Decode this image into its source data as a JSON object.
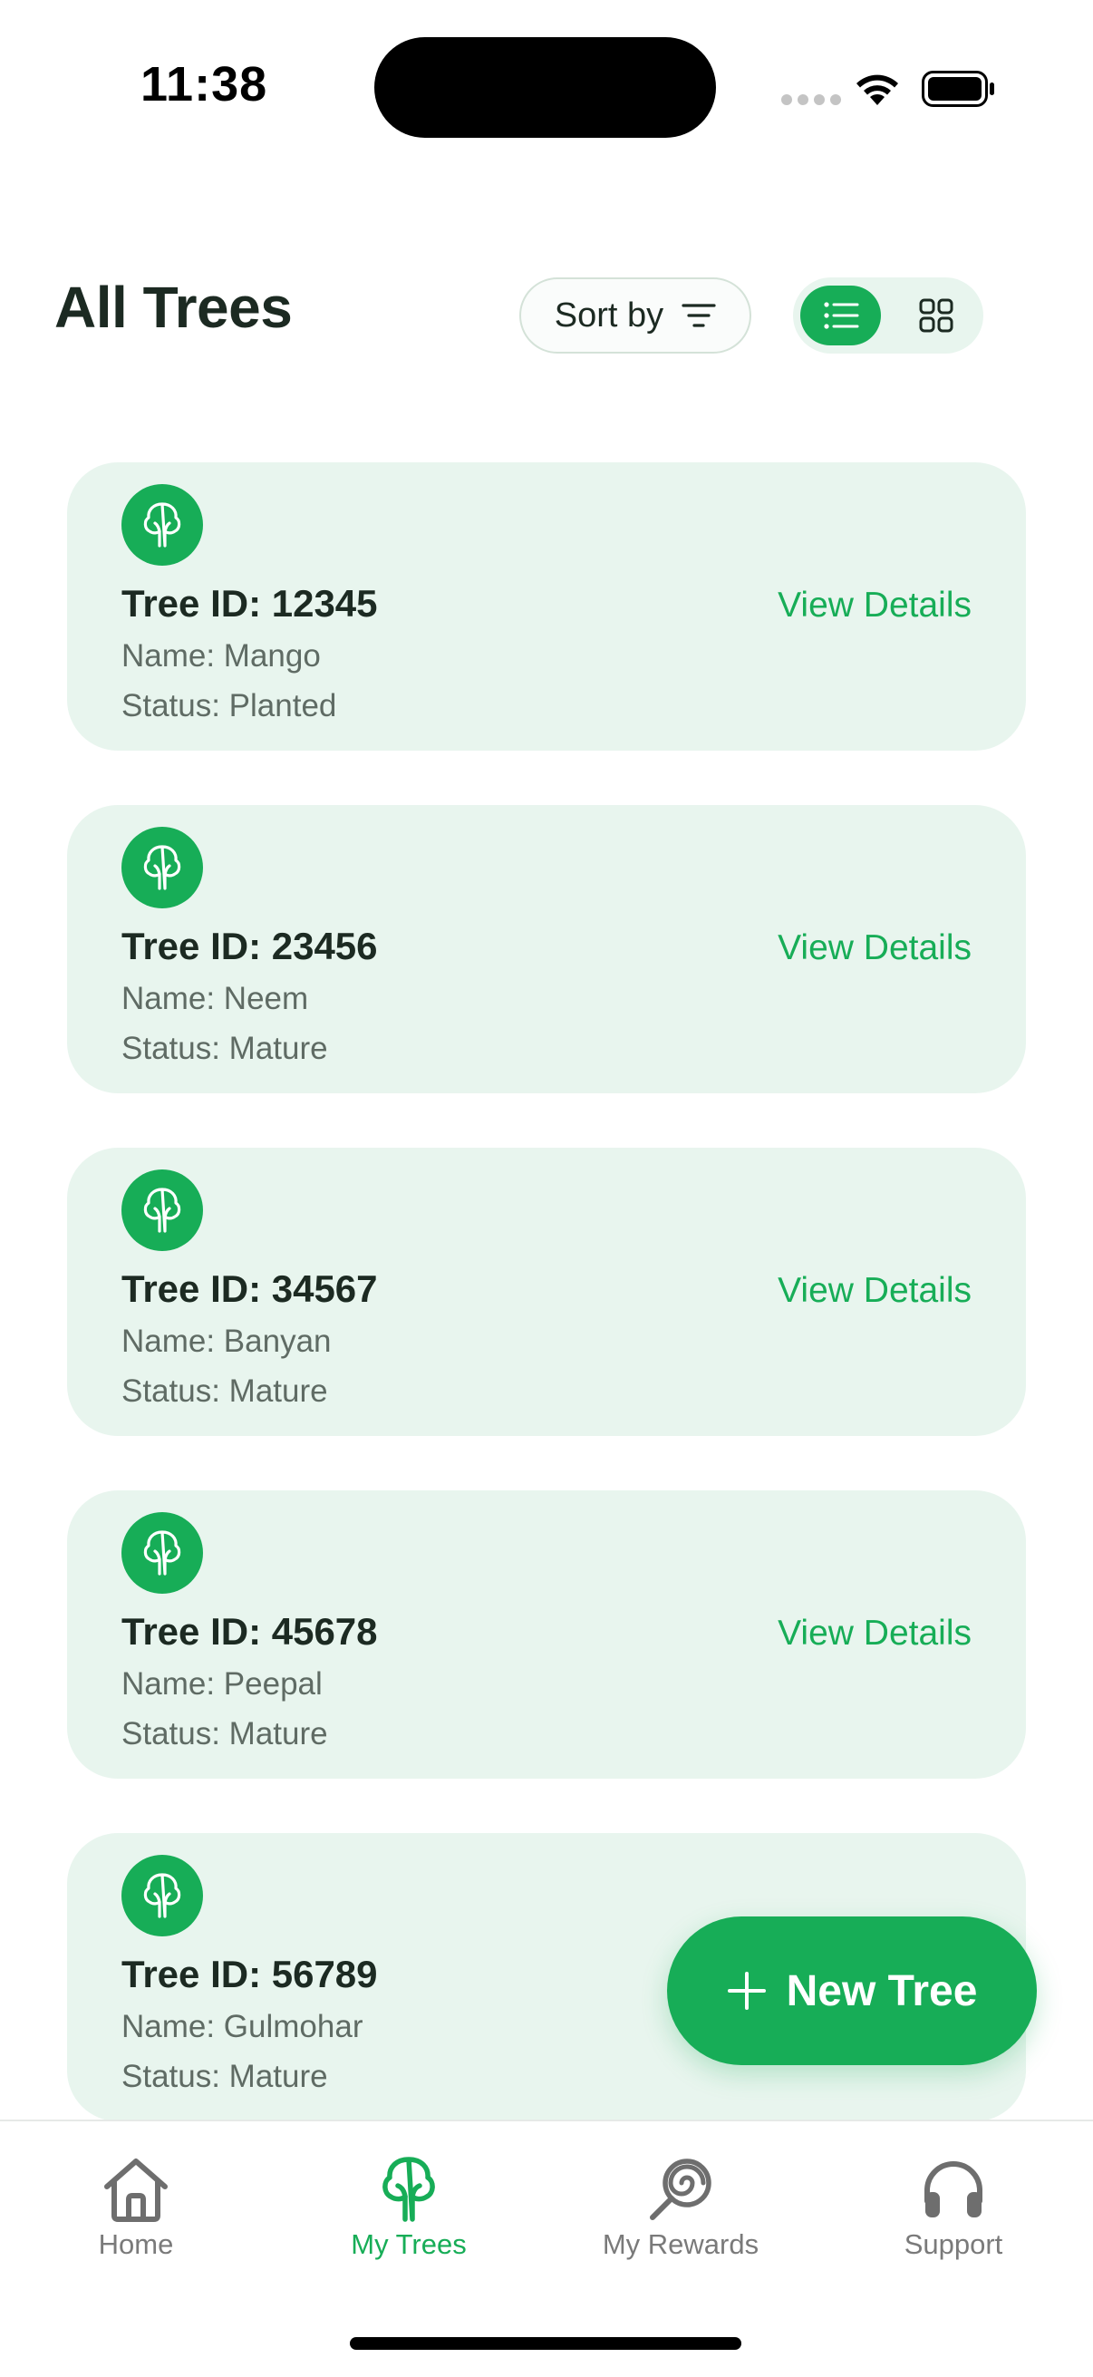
{
  "status_bar": {
    "time": "11:38"
  },
  "header": {
    "title": "All Trees",
    "sort_label": "Sort by",
    "view_modes": [
      "list",
      "grid"
    ],
    "active_view": "list"
  },
  "trees": [
    {
      "id_label": "Tree ID: 12345",
      "name_label": "Name: Mango",
      "status_label": "Status: Planted",
      "action": "View Details"
    },
    {
      "id_label": "Tree ID: 23456",
      "name_label": "Name: Neem",
      "status_label": "Status: Mature",
      "action": "View Details"
    },
    {
      "id_label": "Tree ID: 34567",
      "name_label": "Name: Banyan",
      "status_label": "Status: Mature",
      "action": "View Details"
    },
    {
      "id_label": "Tree ID: 45678",
      "name_label": "Name: Peepal",
      "status_label": "Status: Mature",
      "action": "View Details"
    },
    {
      "id_label": "Tree ID: 56789",
      "name_label": "Name: Gulmohar",
      "status_label": "Status: Mature",
      "action": ""
    }
  ],
  "fab": {
    "label": "New Tree"
  },
  "bottom_nav": {
    "items": [
      {
        "label": "Home",
        "icon": "home-icon"
      },
      {
        "label": "My Trees",
        "icon": "tree-icon"
      },
      {
        "label": "My Rewards",
        "icon": "lollipop-icon"
      },
      {
        "label": "Support",
        "icon": "headset-icon"
      }
    ],
    "active": "My Trees"
  },
  "colors": {
    "accent": "#17ad57",
    "card_bg": "#e8f5ee",
    "text_primary": "#1c2a22",
    "text_secondary": "#5f6b64"
  }
}
